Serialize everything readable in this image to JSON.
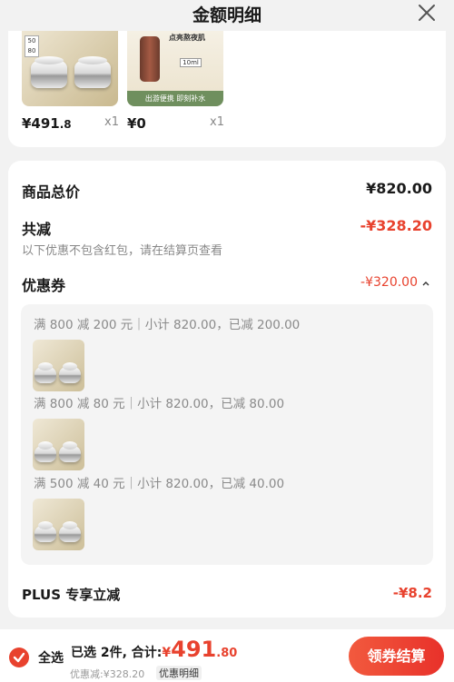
{
  "header": {
    "title": "金额明细"
  },
  "products": [
    {
      "price_main": "¥491",
      "price_decimal": ".8",
      "qty": "x1",
      "img_text": "50 80"
    },
    {
      "price_main": "¥0",
      "price_decimal": "",
      "qty": "x1",
      "img_label": "出游便携 即刻补水",
      "img_volume": "10ml",
      "img_caption": "点亮熬夜肌"
    }
  ],
  "summary": {
    "total_label": "商品总价",
    "total_value": "¥820.00",
    "discount_label": "共减",
    "discount_value": "-¥328.20",
    "discount_note": "以下优惠不包含红包，请在结算页查看",
    "coupon_label": "优惠券",
    "coupon_value": "-¥320.00",
    "coupons": [
      {
        "text": "满 800 减 200 元｜小计 820.00，已减 200.00"
      },
      {
        "text": "满 800 减 80 元｜小计 820.00，已减 80.00"
      },
      {
        "text": "满 500 减 40 元｜小计 820.00，已减 40.00"
      }
    ],
    "plus_label": "PLUS 专享立减",
    "plus_value": "-¥8.2"
  },
  "bottom": {
    "select_all": "全选",
    "selected_text": "已选 2件, 合计:",
    "total_symbol": "¥",
    "total_main": "491",
    "total_decimal": ".80",
    "discount_text": "优惠减:¥328.20",
    "detail_label": "优惠明细",
    "checkout_button": "领券结算"
  },
  "colors": {
    "accent": "#e8422e",
    "background": "#f2f2f2",
    "card": "#ffffff"
  }
}
